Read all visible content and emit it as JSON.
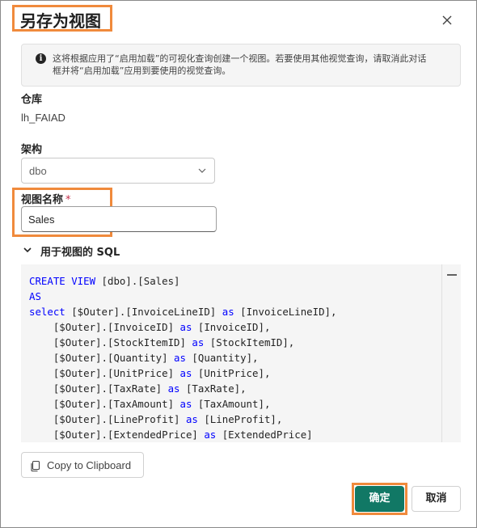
{
  "dialog": {
    "title": "另存为视图",
    "info_icon_glyph": "i",
    "info_text": "这将根据应用了“启用加载”的可视化查询创建一个视图。若要使用其他视觉查询，请取消此对话框并将“启用加载”应用到要使用的视觉查询。"
  },
  "warehouse": {
    "label": "仓库",
    "value": "lh_FAIAD"
  },
  "schema": {
    "label": "架构",
    "selected": "dbo"
  },
  "view_name": {
    "label": "视图名称",
    "required_mark": "*",
    "value": "Sales"
  },
  "sql_section": {
    "toggle_label": "用于视图的 SQL",
    "lines": [
      {
        "k": "CREATE VIEW",
        "r": " [dbo].[Sales]"
      },
      {
        "k": "AS",
        "r": ""
      },
      {
        "k": "select",
        "r": " [$Outer].[InvoiceLineID] ",
        "k2": "as",
        "r2": " [InvoiceLineID],"
      },
      {
        "i": "    ",
        "r": "[$Outer].[InvoiceID] ",
        "k2": "as",
        "r2": " [InvoiceID],"
      },
      {
        "i": "    ",
        "r": "[$Outer].[StockItemID] ",
        "k2": "as",
        "r2": " [StockItemID],"
      },
      {
        "i": "    ",
        "r": "[$Outer].[Quantity] ",
        "k2": "as",
        "r2": " [Quantity],"
      },
      {
        "i": "    ",
        "r": "[$Outer].[UnitPrice] ",
        "k2": "as",
        "r2": " [UnitPrice],"
      },
      {
        "i": "    ",
        "r": "[$Outer].[TaxRate] ",
        "k2": "as",
        "r2": " [TaxRate],"
      },
      {
        "i": "    ",
        "r": "[$Outer].[TaxAmount] ",
        "k2": "as",
        "r2": " [TaxAmount],"
      },
      {
        "i": "    ",
        "r": "[$Outer].[LineProfit] ",
        "k2": "as",
        "r2": " [LineProfit],"
      },
      {
        "i": "    ",
        "r": "[$Outer].[ExtendedPrice] ",
        "k2": "as",
        "r2": " [ExtendedPrice]"
      }
    ]
  },
  "buttons": {
    "copy": "Copy to Clipboard",
    "ok": "确定",
    "cancel": "取消"
  },
  "colors": {
    "primary": "#117865",
    "highlight": "#f08a3c",
    "keyword": "#0000ff"
  },
  "icons": {
    "close": "close-icon",
    "info": "info-icon",
    "chevron": "chevron-down-icon",
    "copy": "copy-icon"
  }
}
